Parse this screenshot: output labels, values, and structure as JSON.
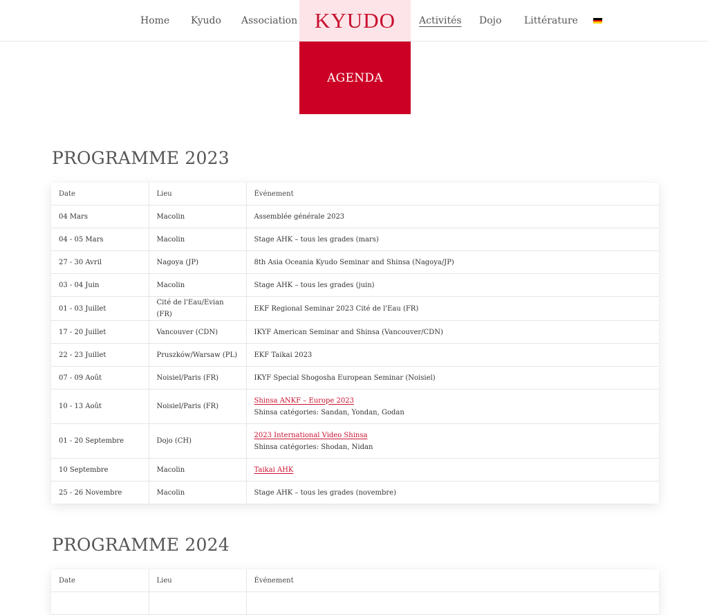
{
  "nav": {
    "items": [
      {
        "label": "Home"
      },
      {
        "label": "Kyudo"
      },
      {
        "label": "Association"
      },
      {
        "label": "Activités",
        "active": true
      },
      {
        "label": "Dojo"
      },
      {
        "label": "Littérature"
      }
    ],
    "logo": "KYUDO",
    "language_icon": "german-flag-icon",
    "flag_colors": [
      "#000000",
      "#dd0000",
      "#ffce00"
    ]
  },
  "banner": {
    "label": "AGENDA"
  },
  "colors": {
    "accent": "#cc0025",
    "logo_bg": "#fce4e8",
    "link": "#c8102e"
  },
  "programs": [
    {
      "title": "PROGRAMME 2023",
      "headers": [
        "Date",
        "Lieu",
        "Événement"
      ],
      "rows": [
        {
          "date": "04 Mars",
          "lieu": "Macolin",
          "event": "Assemblée générale 2023"
        },
        {
          "date": "04 - 05 Mars",
          "lieu": "Macolin",
          "event": "Stage AHK – tous les grades (mars)"
        },
        {
          "date": "27 - 30 Avril",
          "lieu": "Nagoya (JP)",
          "event": "8th Asia Oceania Kyudo Seminar and Shinsa (Nagoya/JP)"
        },
        {
          "date": "03 - 04 Juin",
          "lieu": "Macolin",
          "event": "Stage AHK – tous les grades (juin)"
        },
        {
          "date": "01 - 03 Juillet",
          "lieu": "Cité de l'Eau/Evian (FR)",
          "event": "EKF Regional Seminar 2023 Cité de l'Eau (FR)"
        },
        {
          "date": "17 - 20 Juillet",
          "lieu": "Vancouver (CDN)",
          "event": "IKYF American Seminar and Shinsa (Vancouver/CDN)"
        },
        {
          "date": "22 - 23 Juillet",
          "lieu": "Pruszków/Warsaw (PL)",
          "event": "EKF Taikai 2023"
        },
        {
          "date": "07 - 09 Août",
          "lieu": "Noisiel/Paris (FR)",
          "event": "IKYF Special Shogosha European Seminar (Noisiel)"
        },
        {
          "date": "10 - 13 Août",
          "lieu": "Noisiel/Paris (FR)",
          "event_link": "Shinsa ANKF – Europe 2023",
          "event_note": "Shinsa catégories: Sandan, Yondan, Godan"
        },
        {
          "date": "01 - 20 Septembre",
          "lieu": "Dojo (CH)",
          "event_link": "2023 International Video Shinsa",
          "event_note": "Shinsa catégories: Shodan, Nidan"
        },
        {
          "date": "10 Septembre",
          "lieu": "Macolin",
          "event_link": "Taikai AHK"
        },
        {
          "date": "25 - 26 Novembre",
          "lieu": "Macolin",
          "event": "Stage AHK – tous les grades (novembre)"
        }
      ]
    },
    {
      "title": "PROGRAMME 2024",
      "headers": [
        "Date",
        "Lieu",
        "Événement"
      ],
      "rows": []
    }
  ]
}
